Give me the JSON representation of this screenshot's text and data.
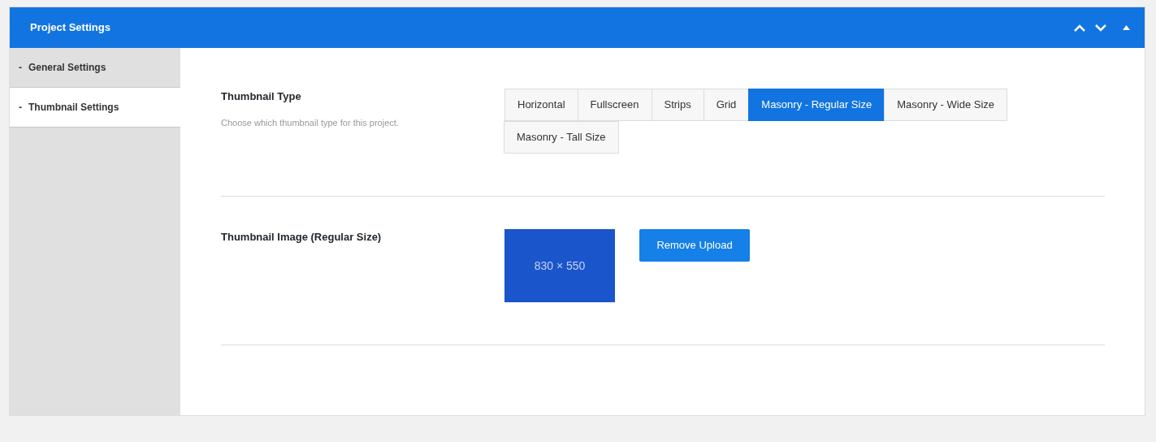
{
  "panel": {
    "title": "Project Settings"
  },
  "sidebar": {
    "items": [
      {
        "marker": "-",
        "label": "General Settings",
        "selected": false
      },
      {
        "marker": "-",
        "label": "Thumbnail Settings",
        "selected": true
      }
    ]
  },
  "fields": [
    {
      "kind": "buttons",
      "label": "Thumbnail Type",
      "description": "Choose which thumbnail type for this project.",
      "options": [
        {
          "label": "Horizontal",
          "selected": false
        },
        {
          "label": "Fullscreen",
          "selected": false
        },
        {
          "label": "Strips",
          "selected": false
        },
        {
          "label": "Grid",
          "selected": false
        },
        {
          "label": "Masonry - Regular Size",
          "selected": true
        },
        {
          "label": "Masonry - Wide Size",
          "selected": false
        },
        {
          "label": "Masonry - Tall Size",
          "selected": false
        }
      ]
    },
    {
      "kind": "upload",
      "label": "Thumbnail Image (Regular Size)",
      "preview_text": "830 × 550",
      "button": "Remove Upload"
    }
  ]
}
